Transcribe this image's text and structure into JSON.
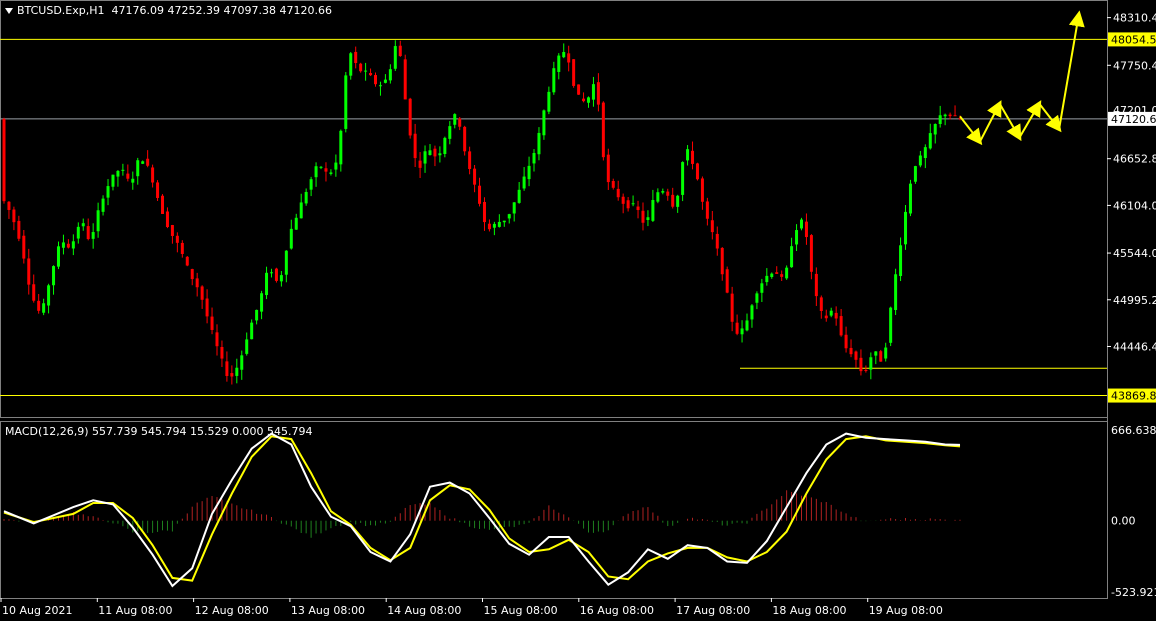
{
  "header": {
    "symbol": "BTCUSD.Exp,H1",
    "ohlc": "47176.09 47252.39 47097.38 47120.66"
  },
  "macd_header": "MACD(12,26,9) 557.739 545.794 15.529 0.000 545.794",
  "colors": {
    "background": "#000000",
    "bull": "#00ff00",
    "bear": "#ff0000",
    "level_line": "#ffff00",
    "macd_line": "#ffffff",
    "signal_line": "#ffff00",
    "hist_pos": "#b22222",
    "hist_neg": "#1e7f1e",
    "axis_text": "#ffffff",
    "frame": "#808080"
  },
  "price_axis": {
    "ticks": [
      "48310.4",
      "47750.4",
      "46652.8",
      "46104.0",
      "45544.0",
      "44995.2",
      "44446.4"
    ]
  },
  "price_labels": {
    "resistance": "48054.5",
    "current": "47120.6",
    "hidden_partial": "47201.0",
    "support": "43869.8"
  },
  "macd_axis": {
    "ticks": [
      "666.638",
      "0.00",
      "-523.921"
    ]
  },
  "time_axis": {
    "labels": [
      "10 Aug 2021",
      "11 Aug 08:00",
      "12 Aug 08:00",
      "13 Aug 08:00",
      "14 Aug 08:00",
      "15 Aug 08:00",
      "16 Aug 08:00",
      "17 Aug 08:00",
      "18 Aug 08:00",
      "19 Aug 08:00"
    ]
  },
  "chart_data": {
    "type": "candlestick",
    "timeframe": "H1",
    "y_range": [
      43700,
      48400
    ],
    "levels": {
      "resistance": 48054.5,
      "support": 43869.8,
      "local_support": 44190,
      "current": 47120.6
    },
    "price_path": [
      [
        0,
        46200
      ],
      [
        2,
        46000
      ],
      [
        4,
        45650
      ],
      [
        6,
        45050
      ],
      [
        8,
        44800
      ],
      [
        10,
        45300
      ],
      [
        12,
        45700
      ],
      [
        14,
        45600
      ],
      [
        16,
        45950
      ],
      [
        18,
        45650
      ],
      [
        20,
        46150
      ],
      [
        22,
        46400
      ],
      [
        24,
        46550
      ],
      [
        26,
        46350
      ],
      [
        28,
        46700
      ],
      [
        30,
        46500
      ],
      [
        32,
        46100
      ],
      [
        34,
        45800
      ],
      [
        36,
        45600
      ],
      [
        38,
        45300
      ],
      [
        40,
        45100
      ],
      [
        42,
        44700
      ],
      [
        44,
        44350
      ],
      [
        46,
        44050
      ],
      [
        48,
        44250
      ],
      [
        50,
        44650
      ],
      [
        52,
        44950
      ],
      [
        54,
        45400
      ],
      [
        56,
        45150
      ],
      [
        58,
        45750
      ],
      [
        60,
        46050
      ],
      [
        62,
        46350
      ],
      [
        64,
        46600
      ],
      [
        66,
        46450
      ],
      [
        68,
        46650
      ],
      [
        70,
        47950
      ],
      [
        72,
        47700
      ],
      [
        74,
        47650
      ],
      [
        76,
        47500
      ],
      [
        78,
        47600
      ],
      [
        80,
        48100
      ],
      [
        82,
        47100
      ],
      [
        84,
        46500
      ],
      [
        86,
        46800
      ],
      [
        88,
        46650
      ],
      [
        90,
        47000
      ],
      [
        92,
        47200
      ],
      [
        94,
        46600
      ],
      [
        96,
        46250
      ],
      [
        98,
        45800
      ],
      [
        100,
        45900
      ],
      [
        102,
        45950
      ],
      [
        104,
        46200
      ],
      [
        106,
        46500
      ],
      [
        108,
        46800
      ],
      [
        110,
        47350
      ],
      [
        112,
        47800
      ],
      [
        114,
        47950
      ],
      [
        116,
        47400
      ],
      [
        118,
        47300
      ],
      [
        120,
        47600
      ],
      [
        122,
        46400
      ],
      [
        124,
        46250
      ],
      [
        126,
        46100
      ],
      [
        128,
        46100
      ],
      [
        130,
        45850
      ],
      [
        132,
        46250
      ],
      [
        134,
        46300
      ],
      [
        136,
        46050
      ],
      [
        138,
        46800
      ],
      [
        140,
        46550
      ],
      [
        142,
        46000
      ],
      [
        144,
        45700
      ],
      [
        146,
        45200
      ],
      [
        148,
        44600
      ],
      [
        150,
        44650
      ],
      [
        152,
        45050
      ],
      [
        154,
        45250
      ],
      [
        156,
        45350
      ],
      [
        158,
        45200
      ],
      [
        160,
        45800
      ],
      [
        162,
        45950
      ],
      [
        164,
        45100
      ],
      [
        166,
        44750
      ],
      [
        168,
        44900
      ],
      [
        170,
        44450
      ],
      [
        172,
        44350
      ],
      [
        174,
        44100
      ],
      [
        176,
        44400
      ],
      [
        178,
        44250
      ],
      [
        180,
        45100
      ],
      [
        182,
        45850
      ],
      [
        184,
        46550
      ],
      [
        186,
        46700
      ],
      [
        188,
        47000
      ],
      [
        190,
        47200
      ],
      [
        192,
        47150
      ],
      [
        193,
        47120
      ]
    ],
    "projection": [
      [
        193,
        47150
      ],
      [
        197,
        46850
      ],
      [
        201,
        47300
      ],
      [
        205,
        46900
      ],
      [
        209,
        47300
      ],
      [
        213,
        47000
      ],
      [
        217,
        48350
      ]
    ],
    "macd": {
      "x": [
        0,
        6,
        10,
        14,
        18,
        22,
        26,
        30,
        34,
        38,
        42,
        46,
        50,
        54,
        58,
        62,
        66,
        70,
        74,
        78,
        82,
        86,
        90,
        94,
        98,
        102,
        106,
        110,
        114,
        118,
        122,
        126,
        130,
        134,
        138,
        142,
        146,
        150,
        154,
        158,
        162,
        166,
        170,
        174,
        178,
        182,
        186,
        190,
        193
      ],
      "main": [
        70,
        -20,
        40,
        100,
        150,
        120,
        -50,
        -250,
        -480,
        -350,
        50,
        300,
        530,
        640,
        560,
        250,
        30,
        -40,
        -230,
        -300,
        -100,
        250,
        280,
        200,
        20,
        -170,
        -250,
        -120,
        -120,
        -300,
        -470,
        -380,
        -210,
        -280,
        -180,
        -200,
        -300,
        -310,
        -150,
        100,
        350,
        560,
        640,
        610,
        600,
        590,
        580,
        560,
        557
      ],
      "signal": [
        60,
        -10,
        20,
        50,
        130,
        130,
        20,
        -180,
        -420,
        -440,
        -100,
        200,
        470,
        620,
        600,
        350,
        70,
        -30,
        -200,
        -290,
        -200,
        150,
        260,
        230,
        80,
        -130,
        -230,
        -210,
        -140,
        -230,
        -410,
        -430,
        -300,
        -240,
        -200,
        -200,
        -270,
        -300,
        -230,
        -80,
        200,
        450,
        600,
        620,
        590,
        580,
        570,
        555,
        546
      ],
      "range": [
        -523.921,
        666.638
      ]
    }
  }
}
